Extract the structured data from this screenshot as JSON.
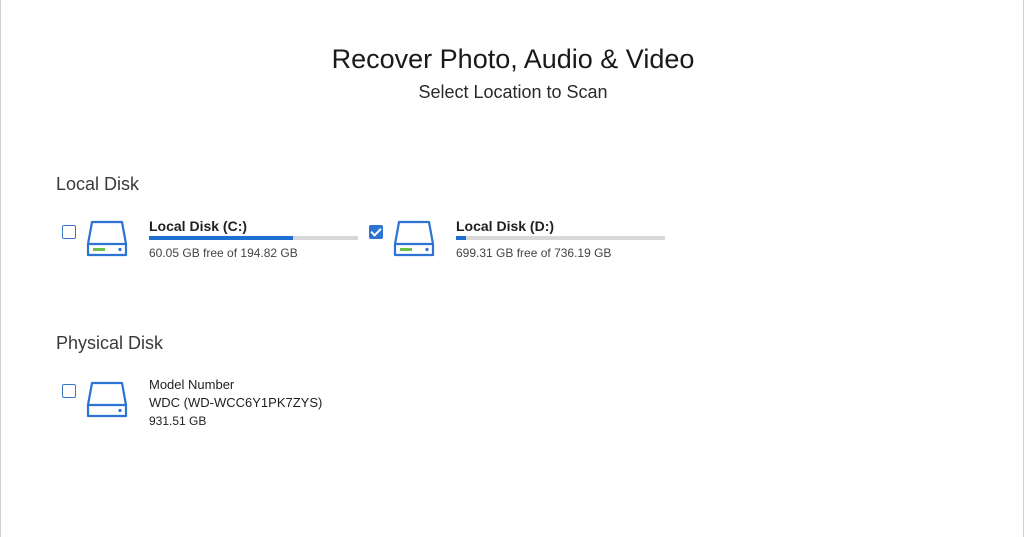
{
  "header": {
    "title": "Recover Photo, Audio & Video",
    "subtitle": "Select Location to Scan"
  },
  "local_disk_section": {
    "label": "Local Disk",
    "disks": [
      {
        "name": "Local Disk (C:)",
        "free_text": "60.05 GB free of 194.82 GB",
        "used_fraction": 0.69,
        "checked": false,
        "icon": "hard-drive-icon"
      },
      {
        "name": "Local Disk (D:)",
        "free_text": "699.31 GB free of 736.19 GB",
        "used_fraction": 0.05,
        "checked": true,
        "icon": "hard-drive-icon"
      }
    ]
  },
  "physical_disk_section": {
    "label": "Physical Disk",
    "disks": [
      {
        "model_label": "Model Number",
        "model": "WDC (WD-WCC6Y1PK7ZYS)",
        "size": "931.51 GB",
        "checked": false,
        "icon": "hard-drive-icon"
      }
    ]
  },
  "colors": {
    "accent": "#1f6fd1",
    "drive_icon": "#2c73d2",
    "drive_led": "#6cbf4a",
    "bar_track": "#d8d8d8"
  }
}
